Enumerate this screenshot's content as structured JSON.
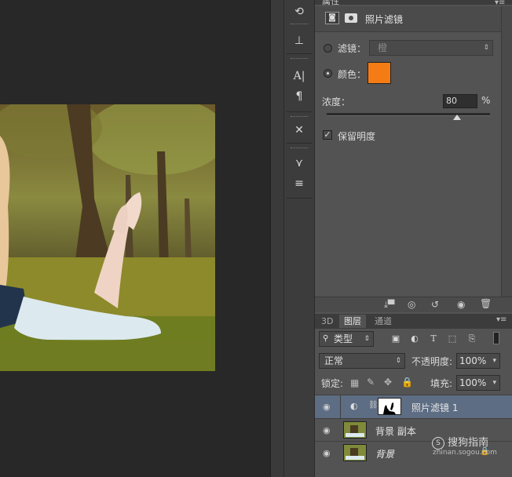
{
  "properties": {
    "title": "属性",
    "header_label": "照片滤镜",
    "filter_label": "滤镜：",
    "filter_value": "橙",
    "color_label": "颜色：",
    "color_value": "#f57c14",
    "density_label": "浓度：",
    "density_value": "80",
    "density_unit": "%",
    "density_percent": 80,
    "preserve_label": "保留明度",
    "preserve_checked": true
  },
  "layers_panel": {
    "tabs": [
      "3D",
      "图层",
      "通道"
    ],
    "active_tab": "图层",
    "kind_label": "类型",
    "blend_mode": "正常",
    "opacity_label": "不透明度:",
    "opacity_value": "100%",
    "lock_label": "锁定:",
    "fill_label": "填充:",
    "fill_value": "100%",
    "layers": [
      {
        "name": "照片滤镜 1",
        "type": "adjustment",
        "selected": true
      },
      {
        "name": "背景 副本",
        "type": "image",
        "selected": false
      },
      {
        "name": "背景",
        "type": "image",
        "selected": false
      }
    ]
  },
  "watermark": {
    "brand": "搜狗指南",
    "url": "zhinan.sogou.com"
  }
}
